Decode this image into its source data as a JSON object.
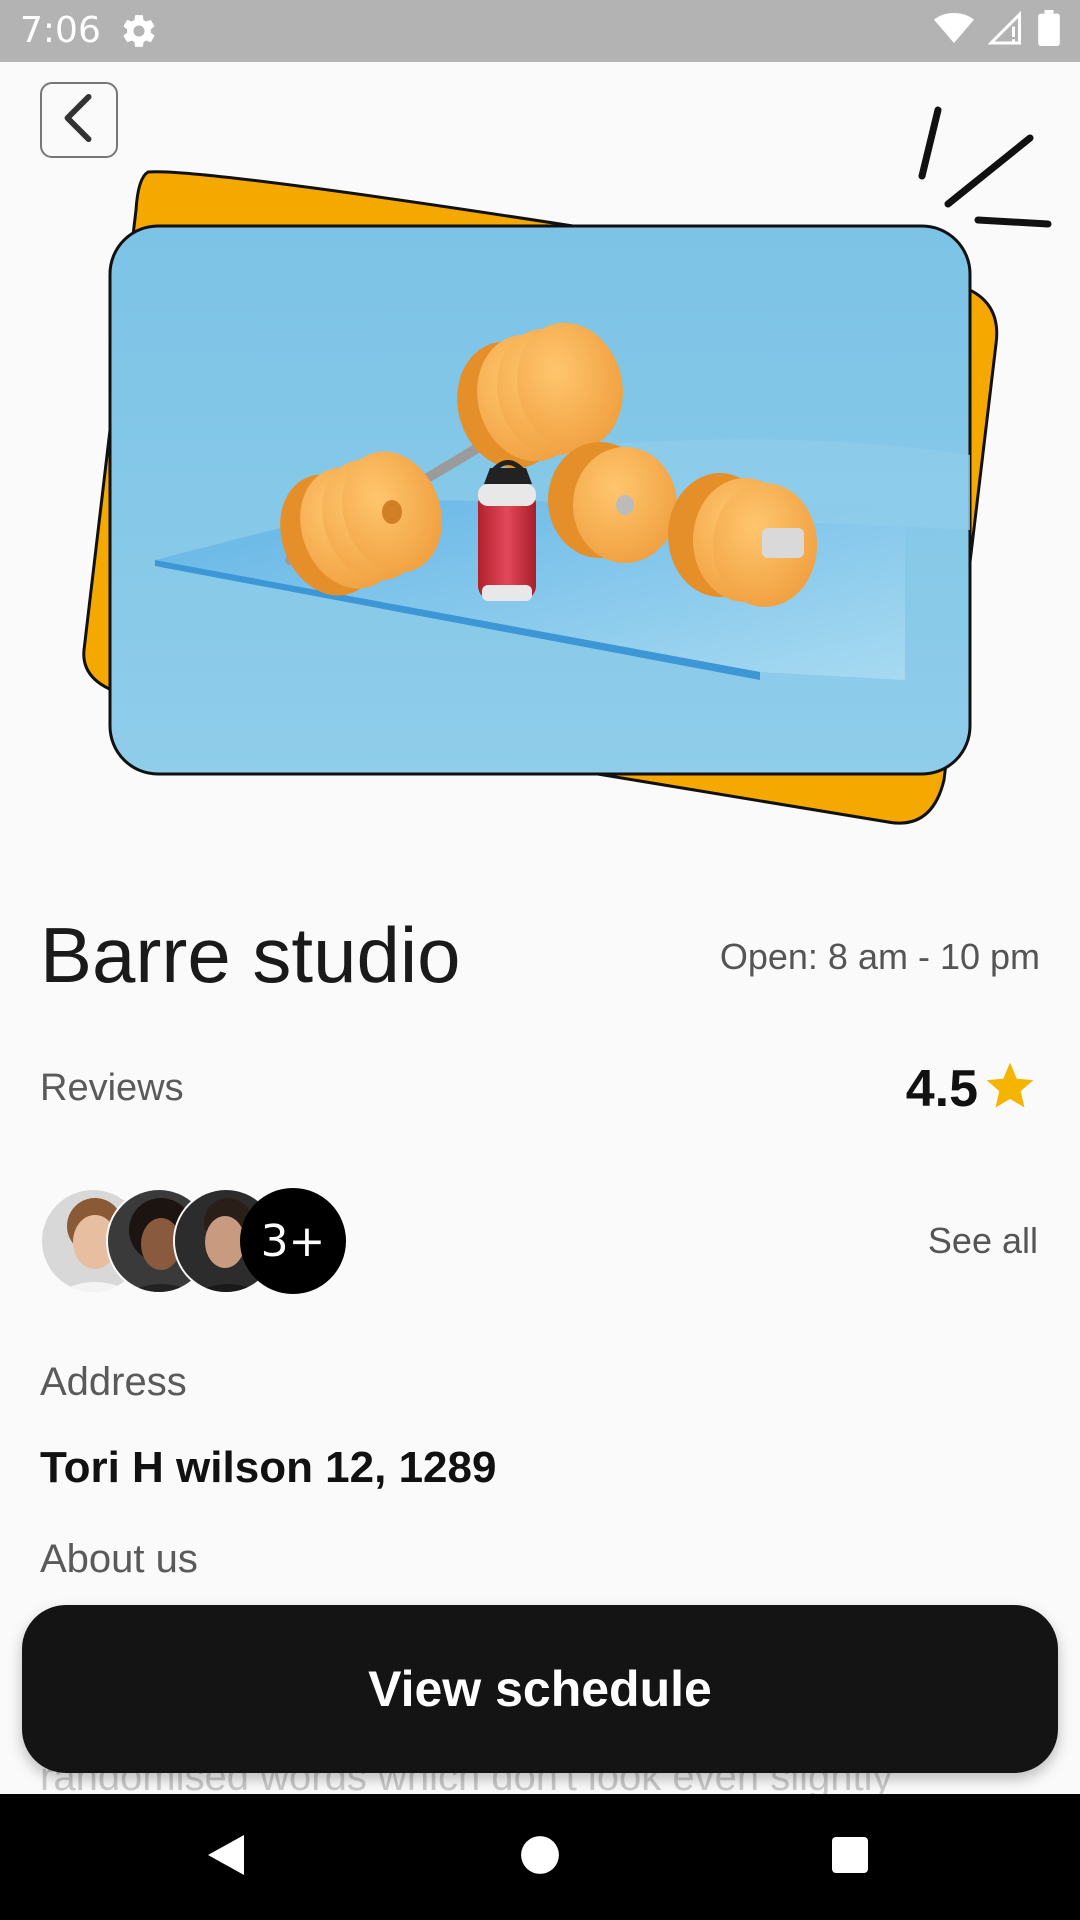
{
  "status_bar": {
    "time": "7:06"
  },
  "gym": {
    "name": "Barre studio",
    "hours": "Open: 8 am - 10 pm"
  },
  "reviews": {
    "label": "Reviews",
    "rating": "4.5",
    "more_count": "3+",
    "see_all": "See all"
  },
  "address": {
    "label": "Address",
    "value": "Tori H wilson 12, 1289"
  },
  "about": {
    "label": "About us",
    "partial_text": "randomised words which don't look even slightly"
  },
  "actions": {
    "view_schedule": "View schedule"
  },
  "colors": {
    "accent": "#F5A800",
    "button": "#141414",
    "star": "#F5B400"
  }
}
